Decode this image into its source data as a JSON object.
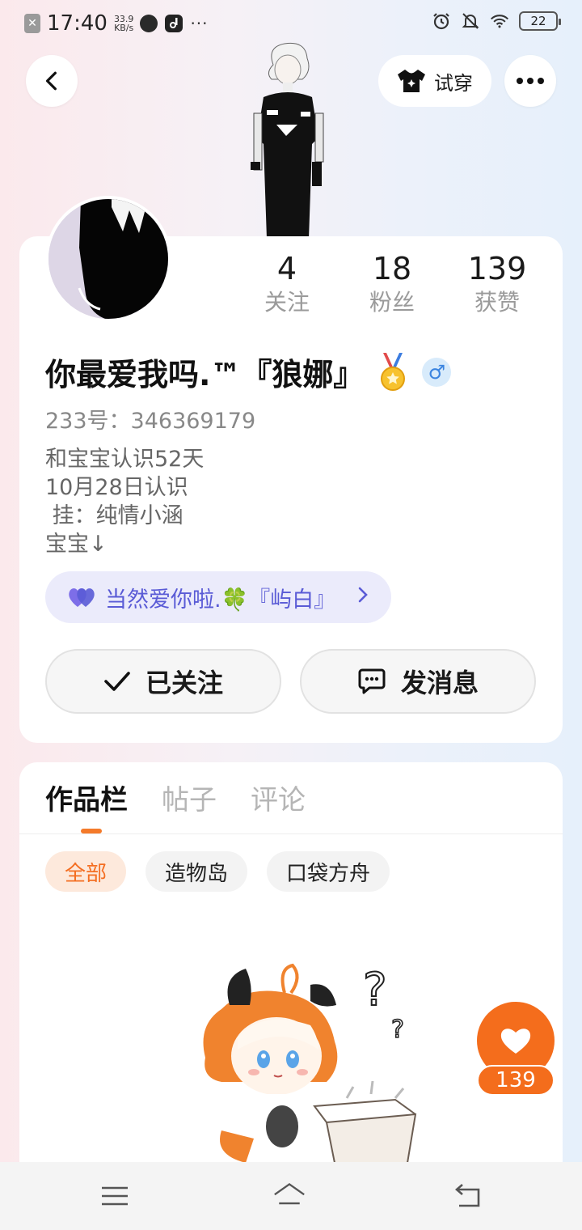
{
  "status_bar": {
    "time": "17:40",
    "net_speed_value": "33.9",
    "net_speed_unit": "KB/s",
    "more": "···",
    "battery": "22"
  },
  "header": {
    "try_on_label": "试穿"
  },
  "profile": {
    "stats": [
      {
        "value": "4",
        "label": "关注"
      },
      {
        "value": "18",
        "label": "粉丝"
      },
      {
        "value": "139",
        "label": "获赞"
      }
    ],
    "nickname": "你最爱我吗.™『狼娜』",
    "gender_symbol": "♂",
    "uid": "233号：346369179",
    "bio": "和宝宝认识52天\n10月28日认识\n 挂：纯情小涵\n宝宝↓",
    "cp_label": "当然爱你啦.🍀『屿白』",
    "followed_label": "已关注",
    "message_label": "发消息"
  },
  "works": {
    "tabs": [
      "作品栏",
      "帖子",
      "评论"
    ],
    "filters": [
      "全部",
      "造物岛",
      "口袋方舟"
    ]
  },
  "like": {
    "count": "139"
  },
  "colors": {
    "accent_orange": "#f46d1c",
    "cp_purple": "#5a5bd6",
    "gender_blue": "#3b84e0"
  }
}
